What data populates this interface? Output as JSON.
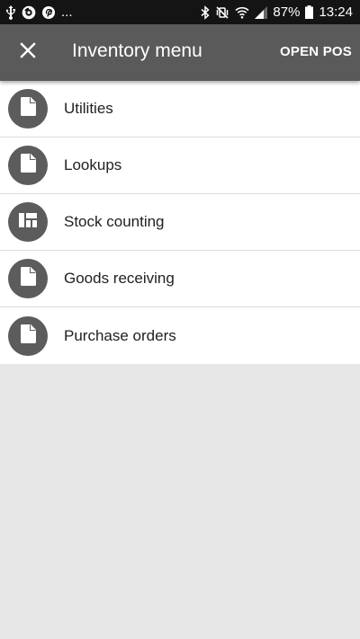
{
  "status_bar": {
    "left_icons": [
      "usb-icon",
      "sync-icon",
      "pinterest-icon"
    ],
    "overflow": "...",
    "right_icons": [
      "bluetooth-icon",
      "vibrate-off-icon",
      "wifi-icon",
      "signal-icon"
    ],
    "battery": "87%",
    "time": "13:24"
  },
  "app_bar": {
    "close_icon": "close-icon",
    "title": "Inventory menu",
    "action_label": "OPEN POS",
    "background": "#5a5a5a"
  },
  "menu": {
    "items": [
      {
        "label": "Utilities",
        "icon": "document-icon"
      },
      {
        "label": "Lookups",
        "icon": "document-icon"
      },
      {
        "label": "Stock counting",
        "icon": "dashboard-icon"
      },
      {
        "label": "Goods receiving",
        "icon": "document-icon"
      },
      {
        "label": "Purchase orders",
        "icon": "document-icon"
      }
    ],
    "avatar_color": "#5c5c5c"
  }
}
